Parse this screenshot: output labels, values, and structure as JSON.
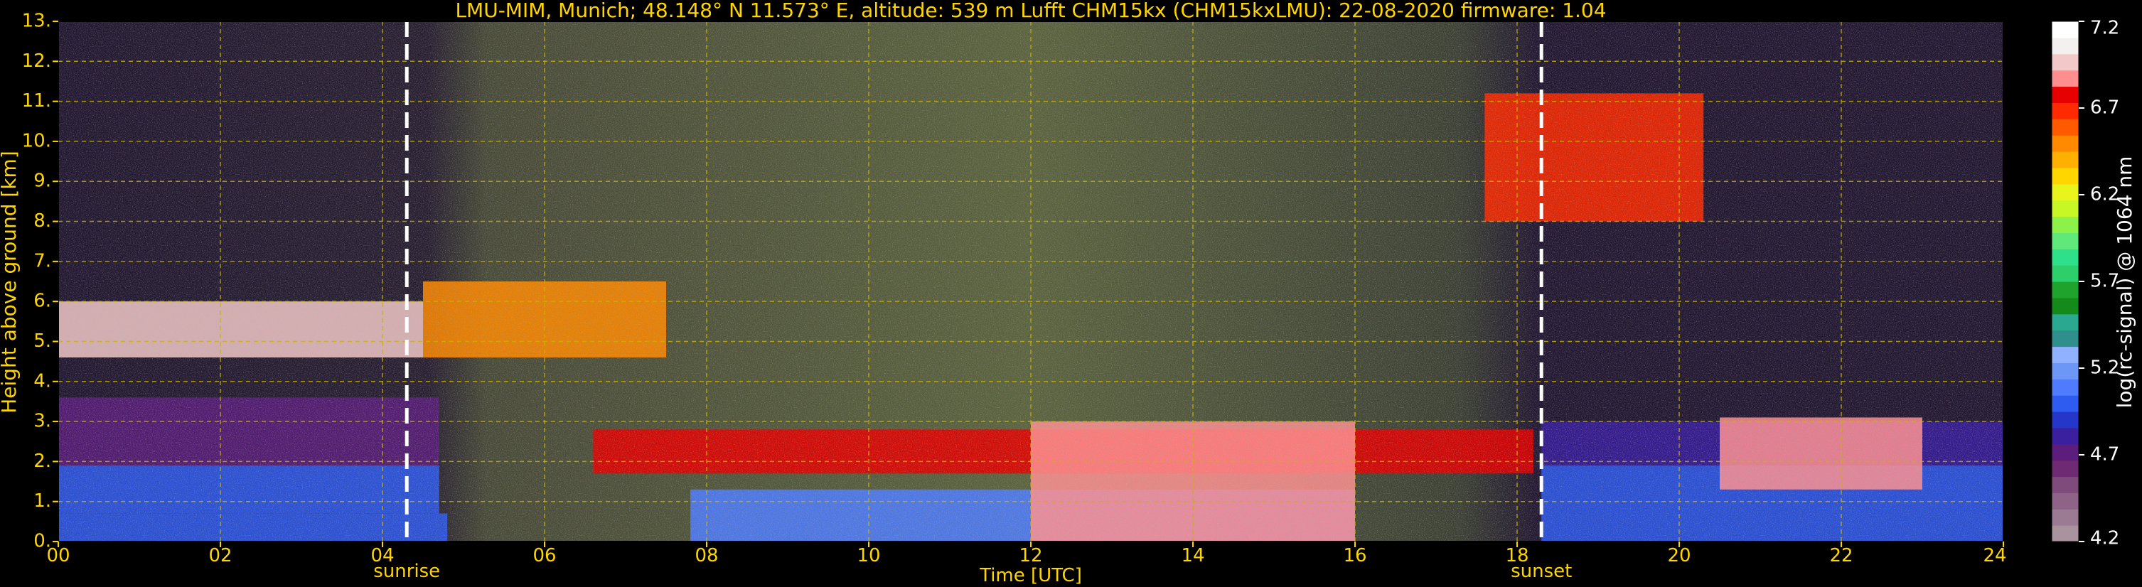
{
  "chart_data": {
    "type": "heatmap",
    "title": "LMU-MIM, Munich; 48.148° N 11.573° E, altitude: 539 m    Lufft CHM15kx (CHM15kxLMU): 22-08-2020    firmware: 1.04",
    "xlabel": "Time [UTC]",
    "ylabel": "Height above ground [km]",
    "xlim": [
      0,
      24
    ],
    "ylim": [
      0,
      13
    ],
    "x_ticks": [
      "00",
      "02",
      "04",
      "06",
      "08",
      "10",
      "12",
      "14",
      "16",
      "18",
      "20",
      "22",
      "24"
    ],
    "y_ticks": [
      "0.",
      "1.",
      "2.",
      "3.",
      "4.",
      "5.",
      "6.",
      "7.",
      "8.",
      "9.",
      "10.",
      "11.",
      "12.",
      "13."
    ],
    "grid": true,
    "markers": [
      {
        "label": "sunrise",
        "time": 4.3
      },
      {
        "label": "sunset",
        "time": 18.3
      }
    ],
    "colorbar": {
      "label": "log(rc-signal) @ 1064 nm",
      "range": [
        4.2,
        7.2
      ],
      "ticks": [
        "4.2",
        "4.7",
        "5.2",
        "5.7",
        "6.2",
        "6.7",
        "7.2"
      ],
      "colors": [
        "#a8939f",
        "#9b7b93",
        "#8e6387",
        "#7f4b7a",
        "#6e2a72",
        "#5c1e7d",
        "#3a1f9e",
        "#2437c9",
        "#2f5cf0",
        "#4f7cff",
        "#6c97f7",
        "#8fb1ff",
        "#2e8f8c",
        "#2aa890",
        "#138a1a",
        "#1fa32c",
        "#2ccf6a",
        "#2ee08a",
        "#61e87a",
        "#8cf24a",
        "#c8f726",
        "#e9f41c",
        "#ffd600",
        "#ffb000",
        "#ff8a00",
        "#ff5a00",
        "#ff2a00",
        "#e60000",
        "#ff8f8f",
        "#f2c8c8",
        "#f5f0f0",
        "#ffffff"
      ]
    },
    "layers": [
      {
        "kind": "boundary_layer",
        "t0": 0,
        "t1": 4.8,
        "h0": 0,
        "h1": 0.7,
        "value": 5.0
      },
      {
        "kind": "residual_layer",
        "t0": 0,
        "t1": 4.7,
        "h0": 0.7,
        "h1": 1.9,
        "value": 5.0
      },
      {
        "kind": "aerosol_layer",
        "t0": 0,
        "t1": 4.7,
        "h0": 1.9,
        "h1": 3.6,
        "value": 4.7
      },
      {
        "kind": "cloud",
        "t0": 0,
        "t1": 4.5,
        "h0": 4.6,
        "h1": 6.0,
        "value": 7.0
      },
      {
        "kind": "cloud",
        "t0": 4.5,
        "t1": 7.5,
        "h0": 4.6,
        "h1": 6.5,
        "value": 6.5
      },
      {
        "kind": "cloud",
        "t0": 6.6,
        "t1": 18.2,
        "h0": 1.7,
        "h1": 2.8,
        "value": 6.8
      },
      {
        "kind": "boundary_layer",
        "t0": 7.8,
        "t1": 16.0,
        "h0": 0,
        "h1": 1.3,
        "value": 5.1
      },
      {
        "kind": "convective_cloud",
        "t0": 12.0,
        "t1": 16.0,
        "h0": 0,
        "h1": 3.0,
        "value": 6.9
      },
      {
        "kind": "cirrus",
        "t0": 17.6,
        "t1": 20.3,
        "h0": 8.0,
        "h1": 11.2,
        "value": 6.7
      },
      {
        "kind": "boundary_layer",
        "t0": 18.3,
        "t1": 24,
        "h0": 0,
        "h1": 1.9,
        "value": 5.0
      },
      {
        "kind": "aerosol_layer",
        "t0": 18.3,
        "t1": 24,
        "h0": 1.9,
        "h1": 3.0,
        "value": 4.8
      },
      {
        "kind": "cloud",
        "t0": 20.5,
        "t1": 23.0,
        "h0": 1.3,
        "h1": 3.1,
        "value": 6.9
      }
    ]
  }
}
